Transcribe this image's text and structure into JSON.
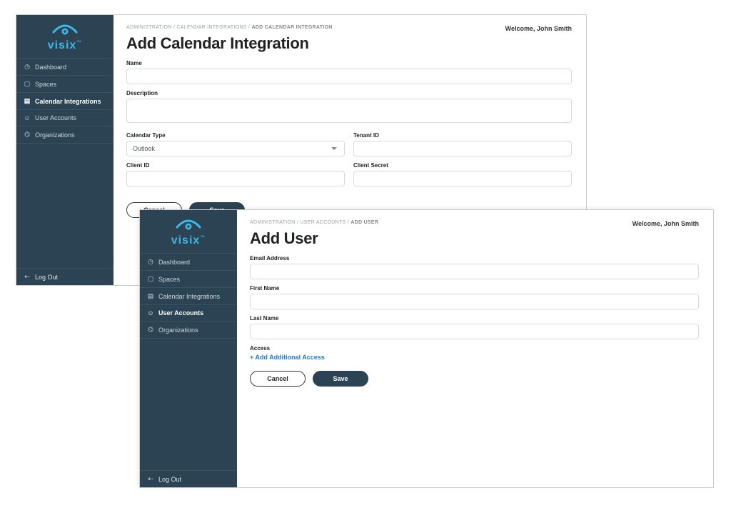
{
  "brand": "visix",
  "welcome": "Welcome, John Smith",
  "logout": "Log Out",
  "nav": {
    "dashboard": "Dashboard",
    "spaces": "Spaces",
    "calendar_integrations": "Calendar Integrations",
    "user_accounts": "User Accounts",
    "organizations": "Organizations"
  },
  "w1": {
    "crumb1": "ADMINISTRATION",
    "crumb2": "CALENDAR INTEGRATIONS",
    "crumb3": "ADD CALENDAR INTEGRATION",
    "title": "Add Calendar Integration",
    "labels": {
      "name": "Name",
      "description": "Description",
      "calendar_type": "Calendar Type",
      "tenant_id": "Tenant ID",
      "client_id": "Client ID",
      "client_secret": "Client Secret"
    },
    "calendar_type_value": "Outlook"
  },
  "w2": {
    "crumb1": "ADMINISTRATION",
    "crumb2": "USER ACCOUNTS",
    "crumb3": "ADD USER",
    "title": "Add User",
    "labels": {
      "email": "Email Address",
      "first_name": "First Name",
      "last_name": "Last Name",
      "access": "Access"
    },
    "add_access": "+ Add Additional Access"
  },
  "buttons": {
    "cancel": "Cancel",
    "save": "Save"
  }
}
